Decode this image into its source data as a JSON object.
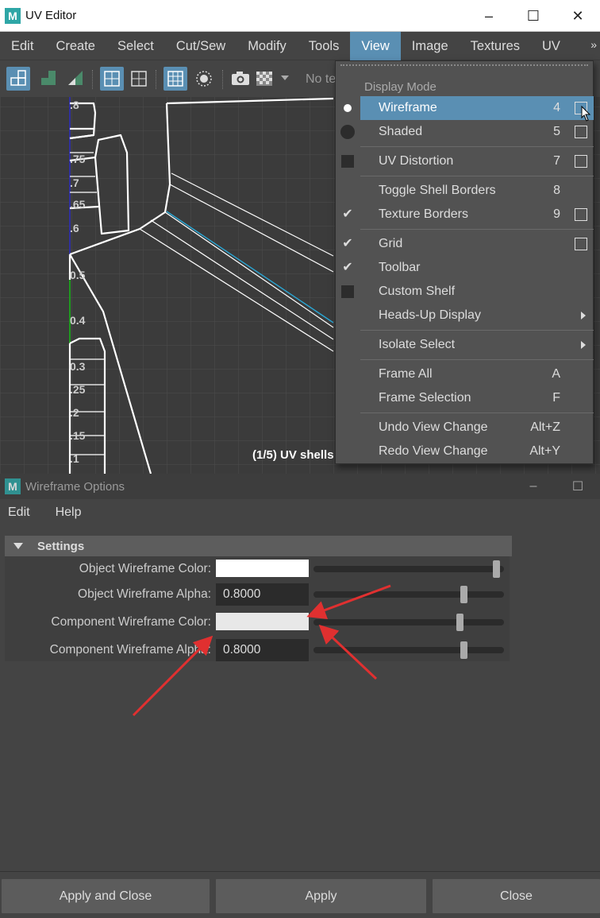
{
  "uv_editor": {
    "title": "UV Editor",
    "menu": [
      "Edit",
      "Create",
      "Select",
      "Cut/Sew",
      "Modify",
      "Tools",
      "View",
      "Image",
      "Textures",
      "UV Sets"
    ],
    "active_menu": "View",
    "overflow_chevron": "»",
    "toolbar_truncated_text": "No te",
    "tick_labels": [
      ".8",
      ".75",
      ".7",
      ".65",
      ".6",
      "0.5",
      "0.4",
      "0.3",
      ".25",
      ".2",
      ".15",
      ".1"
    ],
    "hud": "(1/5) UV shells"
  },
  "view_menu": {
    "section": "Display Mode",
    "items": [
      {
        "label": "Wireframe",
        "shortcut": "4"
      },
      {
        "label": "Shaded",
        "shortcut": "5"
      },
      {
        "label": "UV Distortion",
        "shortcut": "7"
      },
      {
        "label": "Toggle Shell Borders",
        "shortcut": "8"
      },
      {
        "label": "Texture Borders",
        "shortcut": "9"
      },
      {
        "label": "Grid",
        "shortcut": ""
      },
      {
        "label": "Toolbar",
        "shortcut": ""
      },
      {
        "label": "Custom Shelf",
        "shortcut": ""
      },
      {
        "label": "Heads-Up Display",
        "shortcut": ""
      },
      {
        "label": "Isolate Select",
        "shortcut": ""
      },
      {
        "label": "Frame All",
        "shortcut": "A"
      },
      {
        "label": "Frame Selection",
        "shortcut": "F"
      },
      {
        "label": "Undo View Change",
        "shortcut": "Alt+Z"
      },
      {
        "label": "Redo View Change",
        "shortcut": "Alt+Y"
      }
    ],
    "check_glyph": "✔"
  },
  "wireframe_options": {
    "title": "Wireframe Options",
    "menu": [
      "Edit",
      "Help"
    ],
    "section": "Settings",
    "rows": [
      {
        "label": "Object Wireframe Color:",
        "swatch_color": "#ffffff",
        "slider": 0.98
      },
      {
        "label": "Object Wireframe Alpha:",
        "value": "0.8000",
        "slider": 0.8
      },
      {
        "label": "Component Wireframe Color:",
        "swatch_color": "#e8e8e8",
        "slider": 0.78
      },
      {
        "label": "Component Wireframe Alpha:",
        "value": "0.8000",
        "slider": 0.8
      }
    ],
    "buttons": {
      "apply_close": "Apply and Close",
      "apply": "Apply",
      "close": "Close"
    }
  },
  "colors": {
    "accent": "#5a8fb3",
    "annotation_arrow": "#e03030"
  }
}
